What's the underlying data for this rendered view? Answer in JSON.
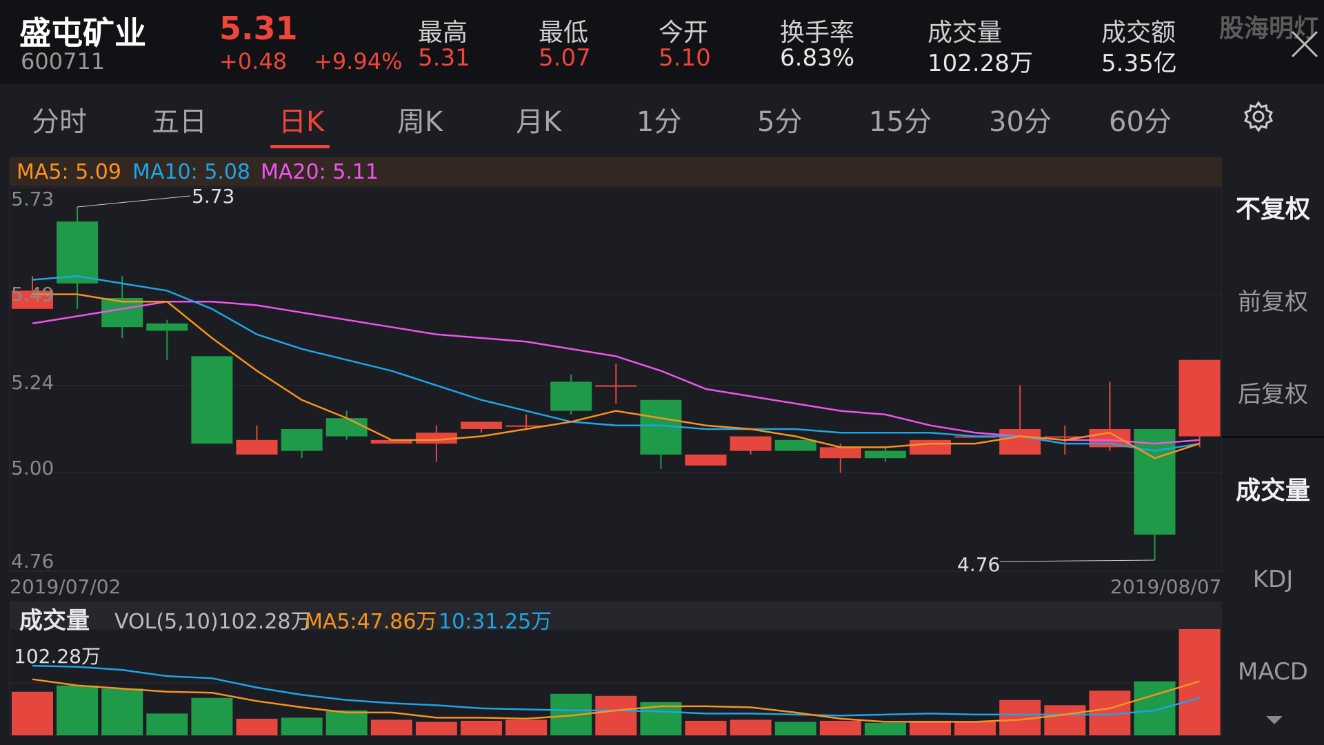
{
  "stock": {
    "name": "盛屯矿业",
    "code": "600711",
    "price": "5.31",
    "change": "+0.48",
    "change_pct": "+9.94%"
  },
  "quote": [
    {
      "label": "最高",
      "value": "5.31",
      "color": "#f0453c"
    },
    {
      "label": "最低",
      "value": "5.07",
      "color": "#f0453c"
    },
    {
      "label": "今开",
      "value": "5.10",
      "color": "#f0453c"
    },
    {
      "label": "换手率",
      "value": "6.83%",
      "color": "#e8e8e8"
    },
    {
      "label": "成交量",
      "value": "102.28万",
      "color": "#e8e8e8"
    },
    {
      "label": "成交额",
      "value": "5.35亿",
      "color": "#e8e8e8"
    }
  ],
  "watermark": "股海明灯",
  "icons": {
    "close": "close-icon",
    "settings": "gear-icon",
    "more": "chevron-down-icon"
  },
  "tabs": [
    "分时",
    "五日",
    "日K",
    "周K",
    "月K",
    "1分",
    "5分",
    "15分",
    "30分",
    "60分"
  ],
  "active_tab": "日K",
  "ma_legend": {
    "ma5": "MA5: 5.09",
    "ma10": "MA10: 5.08",
    "ma20": "MA20: 5.11"
  },
  "price_axis": {
    "labels": [
      "5.73",
      "5.49",
      "5.24",
      "5.00",
      "4.76"
    ]
  },
  "date_range": {
    "start": "2019/07/02",
    "end": "2019/08/07"
  },
  "annotations": {
    "max": "5.73",
    "min": "4.76"
  },
  "volume_legend": {
    "title": "成交量",
    "vol": "VOL(5,10)102.28万",
    "ma5": "MA5:47.86万",
    "ma10": "10:31.25万",
    "max_label": "102.28万"
  },
  "side_menu": [
    "不复权",
    "前复权",
    "后复权",
    "成交量",
    "KDJ",
    "MACD"
  ],
  "colors": {
    "up": "#e5473f",
    "down": "#1f9a48",
    "ma5": "#f7931e",
    "ma10": "#1ea5e9",
    "ma20": "#ee55ee"
  },
  "chart_data": {
    "type": "candlestick",
    "y_range": [
      4.76,
      5.73
    ],
    "candles": [
      {
        "o": 5.45,
        "c": 5.5,
        "h": 5.54,
        "l": 5.45
      },
      {
        "o": 5.69,
        "c": 5.52,
        "h": 5.73,
        "l": 5.45
      },
      {
        "o": 5.48,
        "c": 5.4,
        "h": 5.54,
        "l": 5.37
      },
      {
        "o": 5.41,
        "c": 5.39,
        "h": 5.42,
        "l": 5.31
      },
      {
        "o": 5.32,
        "c": 5.08,
        "h": 5.32,
        "l": 5.08
      },
      {
        "o": 5.05,
        "c": 5.09,
        "h": 5.13,
        "l": 5.05
      },
      {
        "o": 5.12,
        "c": 5.06,
        "h": 5.12,
        "l": 5.04
      },
      {
        "o": 5.15,
        "c": 5.1,
        "h": 5.17,
        "l": 5.09
      },
      {
        "o": 5.08,
        "c": 5.09,
        "h": 5.09,
        "l": 5.08
      },
      {
        "o": 5.08,
        "c": 5.11,
        "h": 5.13,
        "l": 5.03
      },
      {
        "o": 5.12,
        "c": 5.14,
        "h": 5.14,
        "l": 5.11
      },
      {
        "o": 5.13,
        "c": 5.13,
        "h": 5.16,
        "l": 5.12
      },
      {
        "o": 5.25,
        "c": 5.17,
        "h": 5.27,
        "l": 5.16
      },
      {
        "o": 5.24,
        "c": 5.24,
        "h": 5.3,
        "l": 5.19
      },
      {
        "o": 5.2,
        "c": 5.05,
        "h": 5.2,
        "l": 5.01
      },
      {
        "o": 5.02,
        "c": 5.05,
        "h": 5.05,
        "l": 5.02
      },
      {
        "o": 5.06,
        "c": 5.1,
        "h": 5.1,
        "l": 5.05
      },
      {
        "o": 5.09,
        "c": 5.06,
        "h": 5.09,
        "l": 5.06
      },
      {
        "o": 5.04,
        "c": 5.07,
        "h": 5.08,
        "l": 5.0
      },
      {
        "o": 5.06,
        "c": 5.04,
        "h": 5.07,
        "l": 5.03
      },
      {
        "o": 5.05,
        "c": 5.09,
        "h": 5.09,
        "l": 5.05
      },
      {
        "o": 5.1,
        "c": 5.1,
        "h": 5.1,
        "l": 5.1
      },
      {
        "o": 5.05,
        "c": 5.12,
        "h": 5.24,
        "l": 5.05
      },
      {
        "o": 5.1,
        "c": 5.1,
        "h": 5.13,
        "l": 5.05
      },
      {
        "o": 5.07,
        "c": 5.12,
        "h": 5.25,
        "l": 5.06
      },
      {
        "o": 5.12,
        "c": 4.83,
        "h": 5.12,
        "l": 4.76
      },
      {
        "o": 5.1,
        "c": 5.31,
        "h": 5.31,
        "l": 5.07
      }
    ],
    "ma5": [
      5.49,
      5.49,
      5.47,
      5.47,
      5.37,
      5.28,
      5.2,
      5.15,
      5.09,
      5.09,
      5.1,
      5.12,
      5.14,
      5.17,
      5.15,
      5.13,
      5.12,
      5.1,
      5.07,
      5.07,
      5.08,
      5.08,
      5.1,
      5.09,
      5.11,
      5.04,
      5.08
    ],
    "ma10": [
      5.53,
      5.54,
      5.52,
      5.5,
      5.45,
      5.38,
      5.34,
      5.31,
      5.28,
      5.24,
      5.2,
      5.17,
      5.14,
      5.13,
      5.13,
      5.12,
      5.12,
      5.12,
      5.11,
      5.11,
      5.11,
      5.1,
      5.1,
      5.08,
      5.08,
      5.06,
      5.08
    ],
    "ma20": [
      5.41,
      5.43,
      5.45,
      5.47,
      5.47,
      5.46,
      5.44,
      5.42,
      5.4,
      5.38,
      5.37,
      5.36,
      5.34,
      5.32,
      5.28,
      5.23,
      5.21,
      5.19,
      5.17,
      5.16,
      5.13,
      5.11,
      5.1,
      5.09,
      5.09,
      5.08,
      5.09
    ],
    "volume": [
      42,
      48,
      45,
      21,
      36,
      16,
      17,
      24,
      15,
      13,
      14,
      15,
      40,
      38,
      32,
      14,
      15,
      13,
      14,
      12,
      14,
      13,
      34,
      29,
      43,
      52,
      102.28
    ],
    "vol_ma5": [
      54,
      48,
      45,
      42,
      41,
      33,
      27,
      22,
      22,
      17,
      17,
      16,
      19,
      24,
      28,
      28,
      27,
      22,
      16,
      13,
      13,
      13,
      15,
      20,
      26,
      39,
      52
    ],
    "vol_ma10": [
      67,
      66,
      63,
      57,
      55,
      46,
      39,
      34,
      31,
      29,
      26,
      25,
      24,
      24,
      23,
      21,
      21,
      20,
      19,
      20,
      21,
      20,
      20,
      20,
      20,
      24,
      36
    ],
    "vol_range": [
      0,
      102.28
    ]
  }
}
